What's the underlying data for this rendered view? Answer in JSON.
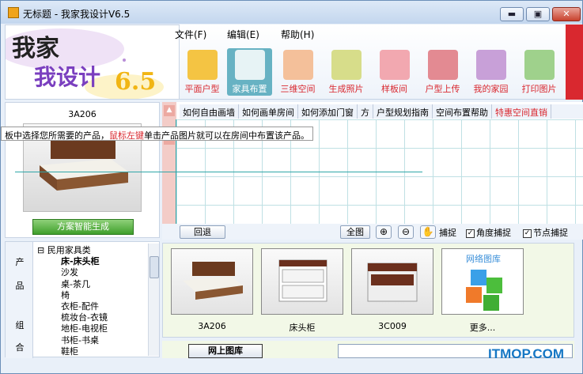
{
  "window": {
    "title": "无标题 - 我家我设计V6.5",
    "min": "▬",
    "max": "▣",
    "close": "✕"
  },
  "logo": {
    "line1": "我家",
    "line2": "我设计",
    "version": "6.5"
  },
  "menu": [
    "文件(F)",
    "编辑(E)",
    "帮助(H)"
  ],
  "toolbar": [
    {
      "label": "平面户型",
      "icon": "pencil-icon",
      "color": "#f4c443"
    },
    {
      "label": "家具布置",
      "icon": "chair-icon",
      "color": "#67b2c3",
      "active": true
    },
    {
      "label": "三维空间",
      "icon": "cube-icon",
      "color": "#f4c09a"
    },
    {
      "label": "生成照片",
      "icon": "camera-icon",
      "color": "#d7dd8a"
    },
    {
      "label": "样板间",
      "icon": "room-icon",
      "color": "#f2a8b0"
    },
    {
      "label": "户型上传",
      "icon": "save-icon",
      "color": "#e38a92"
    },
    {
      "label": "我的家园",
      "icon": "home-icon",
      "color": "#c8a0d8"
    },
    {
      "label": "打印图片",
      "icon": "printer-icon",
      "color": "#9fd18c"
    }
  ],
  "preview": {
    "title": "3A206",
    "generate": "方案智能生成"
  },
  "links": [
    "如何自由画墙",
    "如何画单房间",
    "如何添加门窗",
    "方",
    "户型规划指南",
    "空间布置帮助",
    "特惠空间直销"
  ],
  "tooltip": {
    "part1": "板中选择您所需要的产品，",
    "part2": "鼠标左键",
    "part3": "单击产品图片就可以在房间中布置该产品。"
  },
  "bottom_bar": {
    "undo": "回退",
    "fit": "全图",
    "zoom_in": "⊕",
    "zoom_out": "⊖",
    "pan": "✋",
    "snap1": "捕捉",
    "snap2": "角度捕捉",
    "snap3": "节点捕捉",
    "check": "✓"
  },
  "side_tabs": [
    "产",
    "品",
    "组",
    "合"
  ],
  "tree": [
    "⊟ 民用家具类",
    "  床-床头柜",
    "  沙发",
    "  桌-茶几",
    "  椅",
    "  衣柜-配件",
    "  梳妆台-衣镜",
    "  地柜-电视柜",
    "  书柜-书桌",
    "  鞋柜"
  ],
  "gallery": [
    {
      "name": "3A206"
    },
    {
      "name": "床头柜"
    },
    {
      "name": "3C009"
    },
    {
      "name": "更多..."
    }
  ],
  "online_gallery": "网上图库",
  "net_gallery_label": "网络图库",
  "watermark": "ITMOP.COM"
}
